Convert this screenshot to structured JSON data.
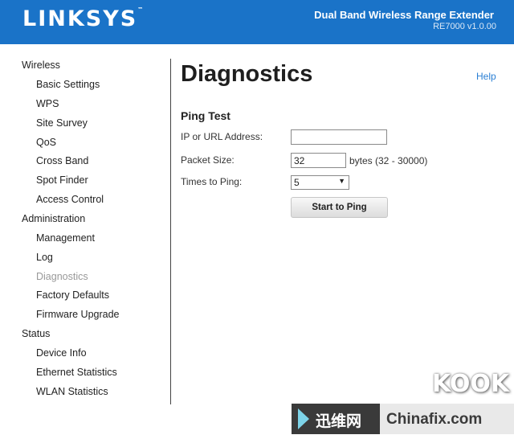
{
  "header": {
    "logo": "LINKSYS",
    "logo_tm": "™",
    "product": "Dual Band Wireless Range Extender",
    "version": "RE7000 v1.0.00"
  },
  "sidebar": {
    "groups": [
      {
        "label": "Wireless",
        "items": [
          "Basic Settings",
          "WPS",
          "Site Survey",
          "QoS",
          "Cross Band",
          "Spot Finder",
          "Access Control"
        ]
      },
      {
        "label": "Administration",
        "items": [
          "Management",
          "Log",
          "Diagnostics",
          "Factory Defaults",
          "Firmware Upgrade"
        ]
      },
      {
        "label": "Status",
        "items": [
          "Device Info",
          "Ethernet Statistics",
          "WLAN Statistics"
        ]
      }
    ],
    "active_item": "Diagnostics"
  },
  "main": {
    "title": "Diagnostics",
    "help": "Help",
    "section": "Ping Test",
    "fields": {
      "ip_label": "IP or URL Address:",
      "ip_value": "",
      "packet_label": "Packet Size:",
      "packet_value": "32",
      "packet_hint": "bytes (32 - 30000)",
      "times_label": "Times to Ping:",
      "times_value": "5"
    },
    "button": "Start to Ping"
  },
  "watermark": {
    "cn_text": "迅维网",
    "site": "Chinafix.com",
    "kook": "KOOK"
  }
}
